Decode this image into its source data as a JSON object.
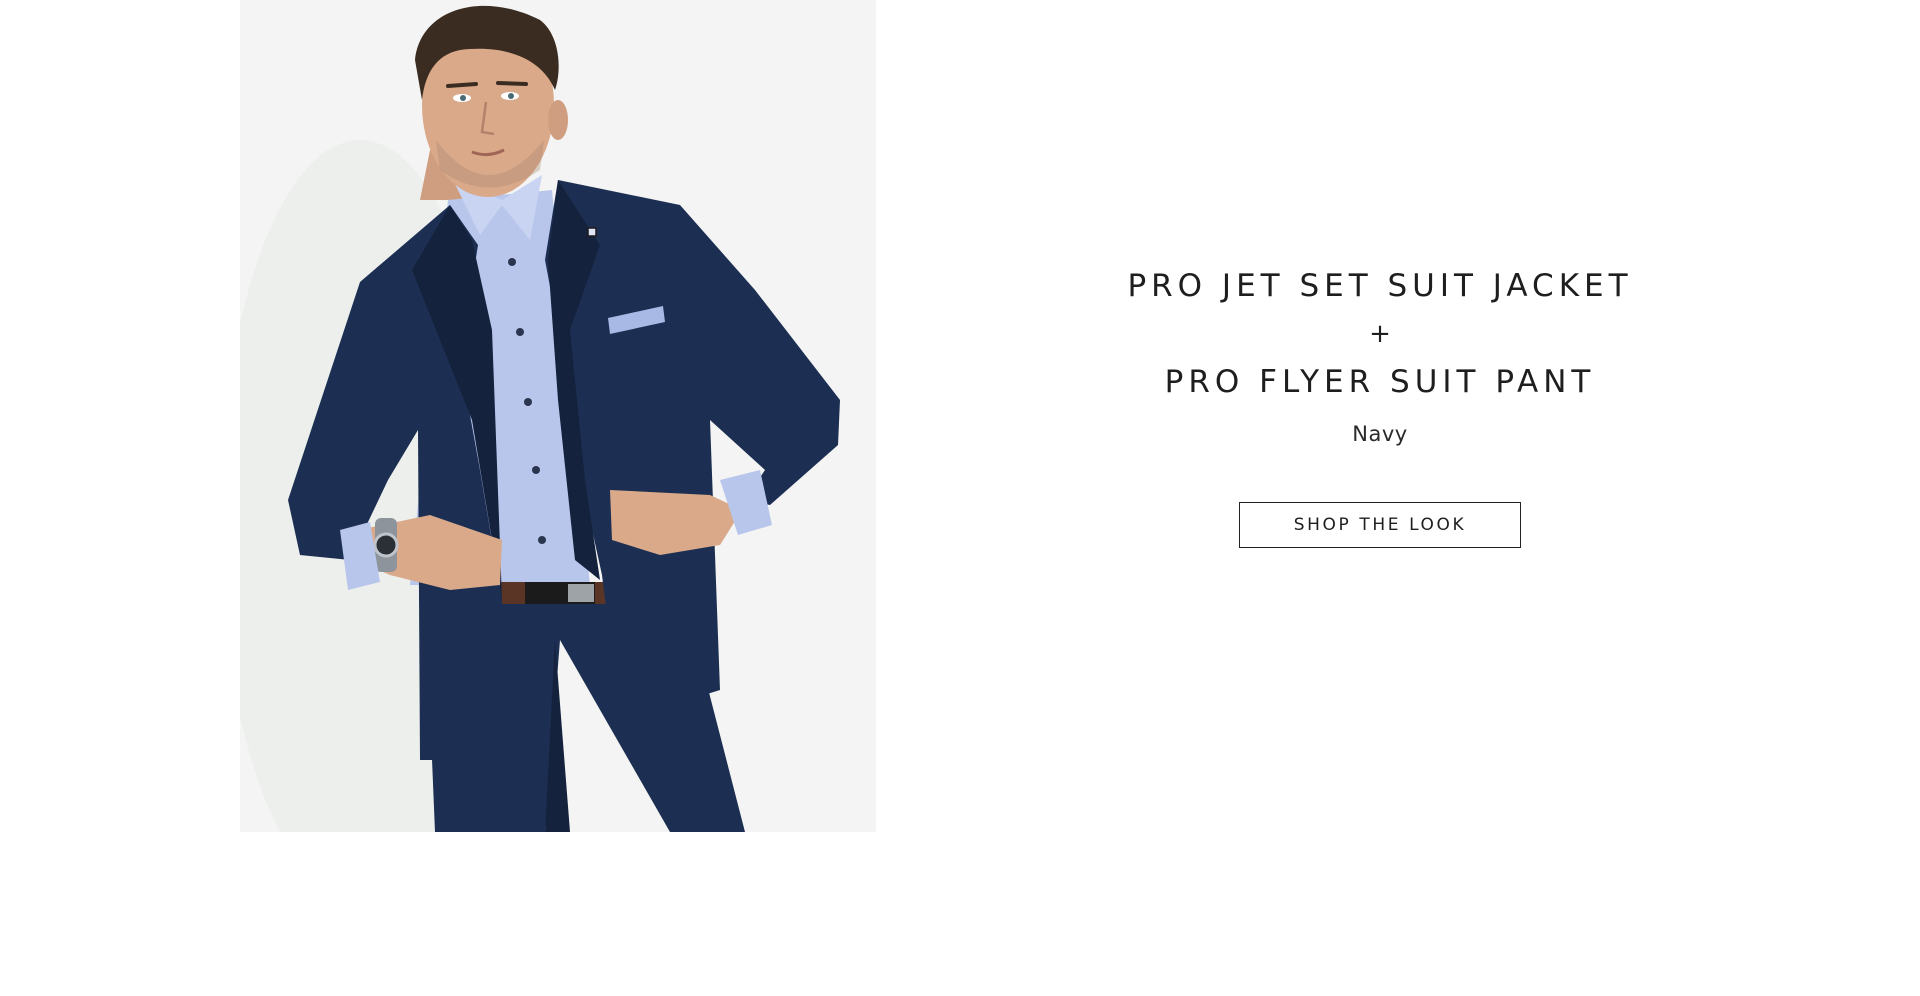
{
  "hero": {
    "alt": "Model wearing navy suit jacket and suit pant with light blue shirt",
    "colors": {
      "background": "#f3f4f3",
      "suit": "#1c2f52",
      "suit_shadow": "#14223d",
      "shirt": "#b9c6ec",
      "skin": "#d9a98a",
      "hair": "#3b2c22",
      "belt": "#5a3526"
    }
  },
  "look": {
    "product_1": "PRO JET SET SUIT JACKET",
    "plus": "+",
    "product_2": "PRO FLYER SUIT PANT",
    "color": "Navy",
    "cta_label": "SHOP THE LOOK"
  }
}
